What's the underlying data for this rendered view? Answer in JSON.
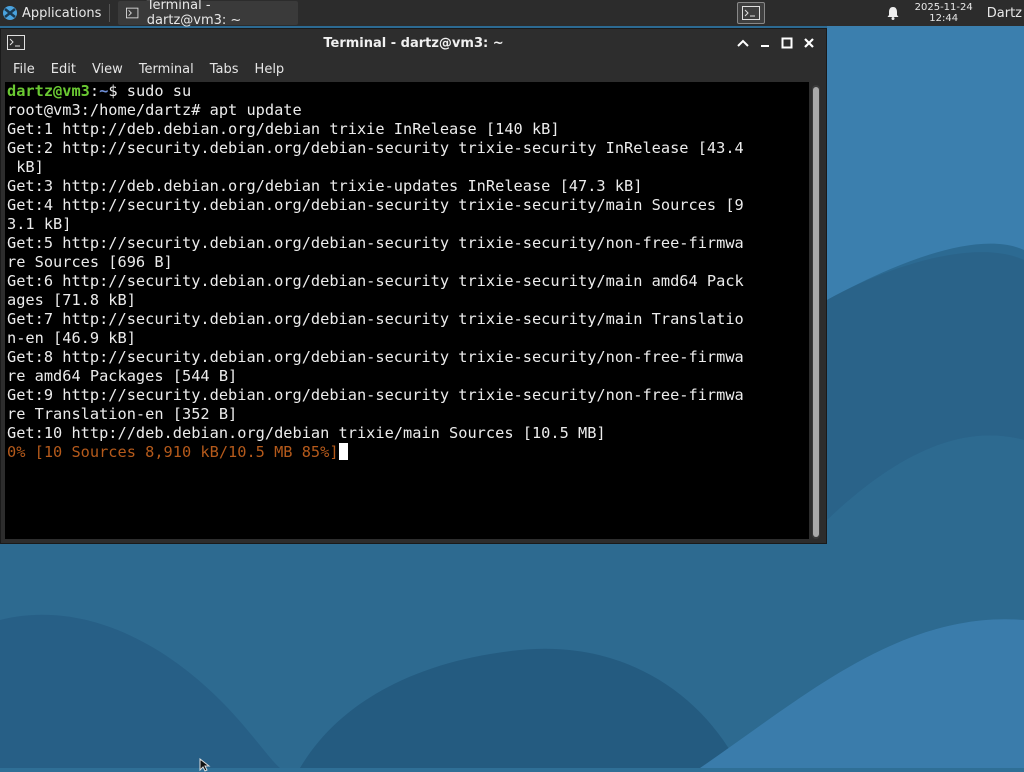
{
  "panel": {
    "applications_label": "Applications",
    "task_label": "Terminal - dartz@vm3: ~",
    "clock_date": "2025-11-24",
    "clock_time": "12:44",
    "user_label": "Dartz"
  },
  "window": {
    "title": "Terminal - dartz@vm3: ~",
    "controls": {
      "maximize_up": "^",
      "minimize": "–",
      "maximize": "☐",
      "close": "✕"
    }
  },
  "menu": [
    "File",
    "Edit",
    "View",
    "Terminal",
    "Tabs",
    "Help"
  ],
  "terminal": {
    "prompt_user": "dartz@vm3",
    "prompt_sep": ":",
    "prompt_path": "~",
    "prompt_cmd": "$ sudo su",
    "lines": [
      "root@vm3:/home/dartz# apt update",
      "Get:1 http://deb.debian.org/debian trixie InRelease [140 kB]",
      "Get:2 http://security.debian.org/debian-security trixie-security InRelease [43.4",
      " kB]",
      "Get:3 http://deb.debian.org/debian trixie-updates InRelease [47.3 kB]",
      "Get:4 http://security.debian.org/debian-security trixie-security/main Sources [9",
      "3.1 kB]",
      "Get:5 http://security.debian.org/debian-security trixie-security/non-free-firmwa",
      "re Sources [696 B]",
      "Get:6 http://security.debian.org/debian-security trixie-security/main amd64 Pack",
      "ages [71.8 kB]",
      "Get:7 http://security.debian.org/debian-security trixie-security/main Translatio",
      "n-en [46.9 kB]",
      "Get:8 http://security.debian.org/debian-security trixie-security/non-free-firmwa",
      "re amd64 Packages [544 B]",
      "Get:9 http://security.debian.org/debian-security trixie-security/non-free-firmwa",
      "re Translation-en [352 B]",
      "Get:10 http://deb.debian.org/debian trixie/main Sources [10.5 MB]"
    ],
    "progress_line": "0% [10 Sources 8,910 kB/10.5 MB 85%]"
  },
  "colors": {
    "prompt_user": "#6ac932",
    "prompt_path": "#6f8fd8",
    "progress": "#b55a1b",
    "desktop": "#2f6f96"
  },
  "icons": {
    "applications": "xfce-apps-icon",
    "terminal": "terminal-icon",
    "bell": "bell-icon"
  }
}
